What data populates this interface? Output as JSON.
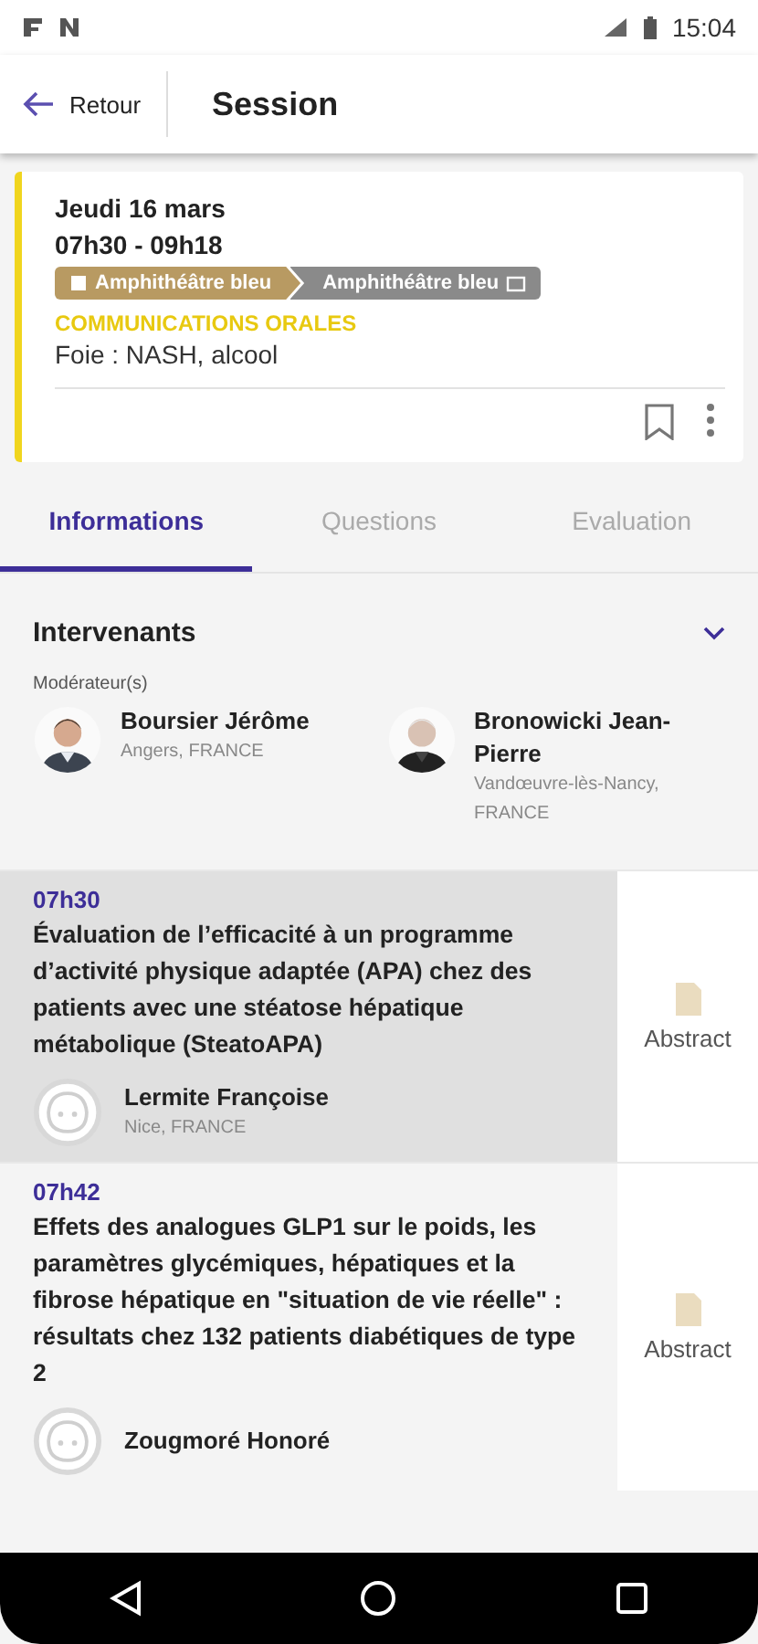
{
  "status_bar": {
    "time": "15:04"
  },
  "header": {
    "back_label": "Retour",
    "title": "Session"
  },
  "session": {
    "date": "Jeudi 16 mars",
    "time": "07h30 - 09h18",
    "rooms": [
      "Amphithéâtre bleu",
      "Amphithéâtre bleu"
    ],
    "category": "COMMUNICATIONS ORALES",
    "topic": "Foie : NASH, alcool",
    "bookmarked": false
  },
  "tabs": [
    {
      "label": "Informations",
      "selected": true
    },
    {
      "label": "Questions",
      "selected": false
    },
    {
      "label": "Evaluation",
      "selected": false
    }
  ],
  "speakers_section": {
    "title": "Intervenants",
    "expanded": true,
    "role": "Modérateur(s)",
    "moderators": [
      {
        "name": "Boursier Jérôme",
        "location": "Angers, FRANCE"
      },
      {
        "name": "Bronowicki Jean-Pierre",
        "location": "Vandœuvre-lès-Nancy, FRANCE"
      }
    ]
  },
  "talks": [
    {
      "time": "07h30",
      "title": "Évaluation de l’efficacité à un programme d’activité physique adaptée (APA) chez des patients avec une stéatose hépatique métabolique (SteatoAPA)",
      "speaker": "Lermite Françoise",
      "location": "Nice, FRANCE",
      "selected": true,
      "abstract_label": "Abstract"
    },
    {
      "time": "07h42",
      "title": "Effets des analogues GLP1 sur le poids, les paramètres glycémiques, hépatiques et la fibrose hépatique en \"situation de vie réelle\" : résultats chez 132 patients diabétiques de type 2",
      "speaker": "Zougmoré Honoré",
      "selected": false,
      "abstract_label": "Abstract"
    }
  ]
}
